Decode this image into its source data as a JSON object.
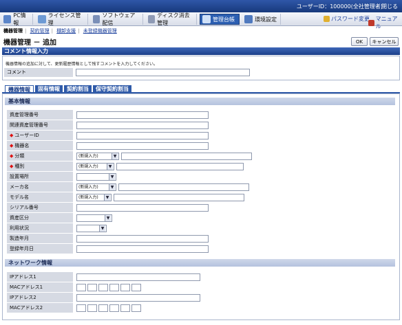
{
  "topbar": {
    "user": "ユーザーID：100000(全社管理者)",
    "logout": "閉じる"
  },
  "nav": {
    "items": [
      {
        "label": "PC情報",
        "icon": "pc-icon"
      },
      {
        "label": "ライセンス管理",
        "icon": "license-icon"
      },
      {
        "label": "ソフトウェア配信",
        "icon": "software-icon"
      },
      {
        "label": "ディスク消去管理",
        "icon": "disk-icon"
      },
      {
        "label": "管理台帳",
        "icon": "ledger-icon"
      },
      {
        "label": "環境設定",
        "icon": "settings-icon"
      }
    ],
    "password": "パスワード変更",
    "manual": "マニュアル"
  },
  "subnav": {
    "items": [
      "機器管理",
      "契約管理",
      "棚卸支援",
      "未登録機器管理"
    ]
  },
  "page": {
    "title": "機器管理 － 追加",
    "ok": "OK",
    "cancel": "キャンセル"
  },
  "comment": {
    "header": "コメント情報入力",
    "note": "機器情報の追加に対して、更新履歴情報として残すコメントを入力してください。",
    "label": "コメント"
  },
  "tabs": [
    "機器情報",
    "固有情報",
    "契約割当",
    "保守契約割当"
  ],
  "basic": {
    "header": "基本情報",
    "fields": [
      {
        "label": "資産管理番号"
      },
      {
        "label": "関連資産管理番号"
      },
      {
        "label": "ユーザーID"
      },
      {
        "label": "機器名"
      },
      {
        "label": "分類",
        "select": "(新規入力)"
      },
      {
        "label": "種別",
        "select": "(新規入力)"
      },
      {
        "label": "設置場所"
      },
      {
        "label": "メーカ名",
        "select": "(新規入力)"
      },
      {
        "label": "モデル名",
        "select": "(新規入力)"
      },
      {
        "label": "シリアル番号"
      },
      {
        "label": "資産区分"
      },
      {
        "label": "利用状況"
      },
      {
        "label": "製造年月"
      },
      {
        "label": "登録年月日"
      }
    ]
  },
  "network": {
    "header": "ネットワーク情報",
    "fields": [
      {
        "label": "IPアドレス1"
      },
      {
        "label": "MACアドレス1"
      },
      {
        "label": "IPアドレス2"
      },
      {
        "label": "MACアドレス2"
      }
    ]
  },
  "colors": {
    "nav_active": "#2c5fb2",
    "header": "#1b3f8a",
    "required": "#dd1111"
  }
}
